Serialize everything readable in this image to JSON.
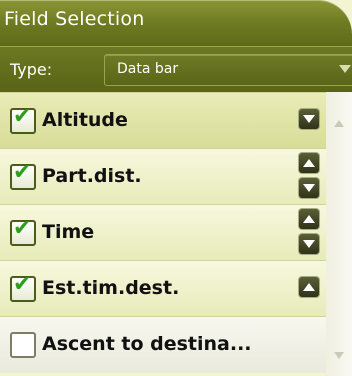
{
  "header": {
    "title": "Field Selection"
  },
  "type_selector": {
    "label": "Type:",
    "value": "Data bar"
  },
  "fields": [
    {
      "label": "Altitude",
      "checked": true,
      "selected": true
    },
    {
      "label": "Part.dist.",
      "checked": true
    },
    {
      "label": "Time",
      "checked": true
    },
    {
      "label": "Est.tim.dest.",
      "checked": true
    },
    {
      "label": "Ascent to destina...",
      "checked": false
    }
  ],
  "icons": {
    "check": "check-mark-icon",
    "up": "arrow-up-icon",
    "down": "arrow-down-icon"
  },
  "colors": {
    "header": "#6f7b22",
    "list_bg": "#e9ecb7",
    "check": "#2f9e1e"
  }
}
